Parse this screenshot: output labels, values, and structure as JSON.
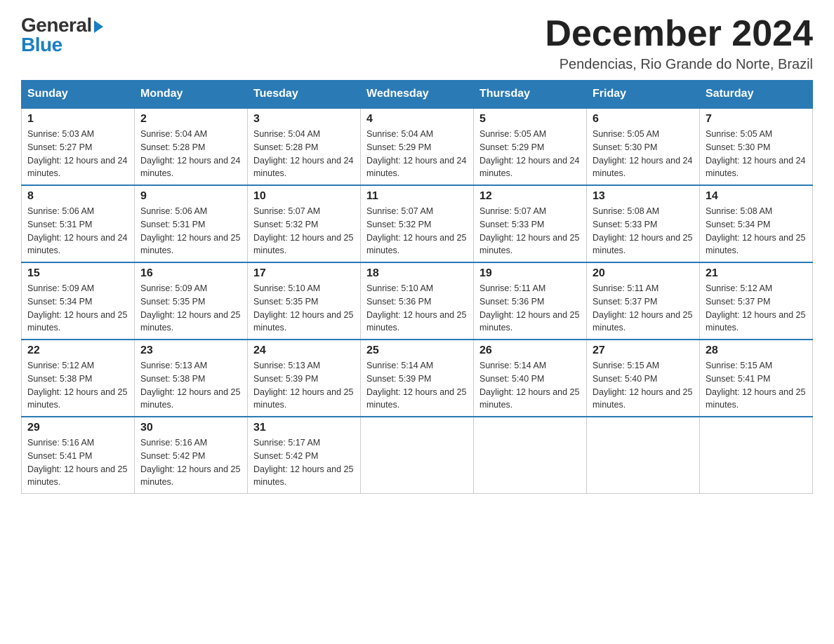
{
  "header": {
    "logo_general": "General",
    "logo_blue": "Blue",
    "month_title": "December 2024",
    "location": "Pendencias, Rio Grande do Norte, Brazil"
  },
  "days_of_week": [
    "Sunday",
    "Monday",
    "Tuesday",
    "Wednesday",
    "Thursday",
    "Friday",
    "Saturday"
  ],
  "weeks": [
    [
      {
        "day": "1",
        "sunrise": "5:03 AM",
        "sunset": "5:27 PM",
        "daylight": "12 hours and 24 minutes."
      },
      {
        "day": "2",
        "sunrise": "5:04 AM",
        "sunset": "5:28 PM",
        "daylight": "12 hours and 24 minutes."
      },
      {
        "day": "3",
        "sunrise": "5:04 AM",
        "sunset": "5:28 PM",
        "daylight": "12 hours and 24 minutes."
      },
      {
        "day": "4",
        "sunrise": "5:04 AM",
        "sunset": "5:29 PM",
        "daylight": "12 hours and 24 minutes."
      },
      {
        "day": "5",
        "sunrise": "5:05 AM",
        "sunset": "5:29 PM",
        "daylight": "12 hours and 24 minutes."
      },
      {
        "day": "6",
        "sunrise": "5:05 AM",
        "sunset": "5:30 PM",
        "daylight": "12 hours and 24 minutes."
      },
      {
        "day": "7",
        "sunrise": "5:05 AM",
        "sunset": "5:30 PM",
        "daylight": "12 hours and 24 minutes."
      }
    ],
    [
      {
        "day": "8",
        "sunrise": "5:06 AM",
        "sunset": "5:31 PM",
        "daylight": "12 hours and 24 minutes."
      },
      {
        "day": "9",
        "sunrise": "5:06 AM",
        "sunset": "5:31 PM",
        "daylight": "12 hours and 25 minutes."
      },
      {
        "day": "10",
        "sunrise": "5:07 AM",
        "sunset": "5:32 PM",
        "daylight": "12 hours and 25 minutes."
      },
      {
        "day": "11",
        "sunrise": "5:07 AM",
        "sunset": "5:32 PM",
        "daylight": "12 hours and 25 minutes."
      },
      {
        "day": "12",
        "sunrise": "5:07 AM",
        "sunset": "5:33 PM",
        "daylight": "12 hours and 25 minutes."
      },
      {
        "day": "13",
        "sunrise": "5:08 AM",
        "sunset": "5:33 PM",
        "daylight": "12 hours and 25 minutes."
      },
      {
        "day": "14",
        "sunrise": "5:08 AM",
        "sunset": "5:34 PM",
        "daylight": "12 hours and 25 minutes."
      }
    ],
    [
      {
        "day": "15",
        "sunrise": "5:09 AM",
        "sunset": "5:34 PM",
        "daylight": "12 hours and 25 minutes."
      },
      {
        "day": "16",
        "sunrise": "5:09 AM",
        "sunset": "5:35 PM",
        "daylight": "12 hours and 25 minutes."
      },
      {
        "day": "17",
        "sunrise": "5:10 AM",
        "sunset": "5:35 PM",
        "daylight": "12 hours and 25 minutes."
      },
      {
        "day": "18",
        "sunrise": "5:10 AM",
        "sunset": "5:36 PM",
        "daylight": "12 hours and 25 minutes."
      },
      {
        "day": "19",
        "sunrise": "5:11 AM",
        "sunset": "5:36 PM",
        "daylight": "12 hours and 25 minutes."
      },
      {
        "day": "20",
        "sunrise": "5:11 AM",
        "sunset": "5:37 PM",
        "daylight": "12 hours and 25 minutes."
      },
      {
        "day": "21",
        "sunrise": "5:12 AM",
        "sunset": "5:37 PM",
        "daylight": "12 hours and 25 minutes."
      }
    ],
    [
      {
        "day": "22",
        "sunrise": "5:12 AM",
        "sunset": "5:38 PM",
        "daylight": "12 hours and 25 minutes."
      },
      {
        "day": "23",
        "sunrise": "5:13 AM",
        "sunset": "5:38 PM",
        "daylight": "12 hours and 25 minutes."
      },
      {
        "day": "24",
        "sunrise": "5:13 AM",
        "sunset": "5:39 PM",
        "daylight": "12 hours and 25 minutes."
      },
      {
        "day": "25",
        "sunrise": "5:14 AM",
        "sunset": "5:39 PM",
        "daylight": "12 hours and 25 minutes."
      },
      {
        "day": "26",
        "sunrise": "5:14 AM",
        "sunset": "5:40 PM",
        "daylight": "12 hours and 25 minutes."
      },
      {
        "day": "27",
        "sunrise": "5:15 AM",
        "sunset": "5:40 PM",
        "daylight": "12 hours and 25 minutes."
      },
      {
        "day": "28",
        "sunrise": "5:15 AM",
        "sunset": "5:41 PM",
        "daylight": "12 hours and 25 minutes."
      }
    ],
    [
      {
        "day": "29",
        "sunrise": "5:16 AM",
        "sunset": "5:41 PM",
        "daylight": "12 hours and 25 minutes."
      },
      {
        "day": "30",
        "sunrise": "5:16 AM",
        "sunset": "5:42 PM",
        "daylight": "12 hours and 25 minutes."
      },
      {
        "day": "31",
        "sunrise": "5:17 AM",
        "sunset": "5:42 PM",
        "daylight": "12 hours and 25 minutes."
      },
      null,
      null,
      null,
      null
    ]
  ],
  "labels": {
    "sunrise_prefix": "Sunrise: ",
    "sunset_prefix": "Sunset: ",
    "daylight_prefix": "Daylight: "
  }
}
